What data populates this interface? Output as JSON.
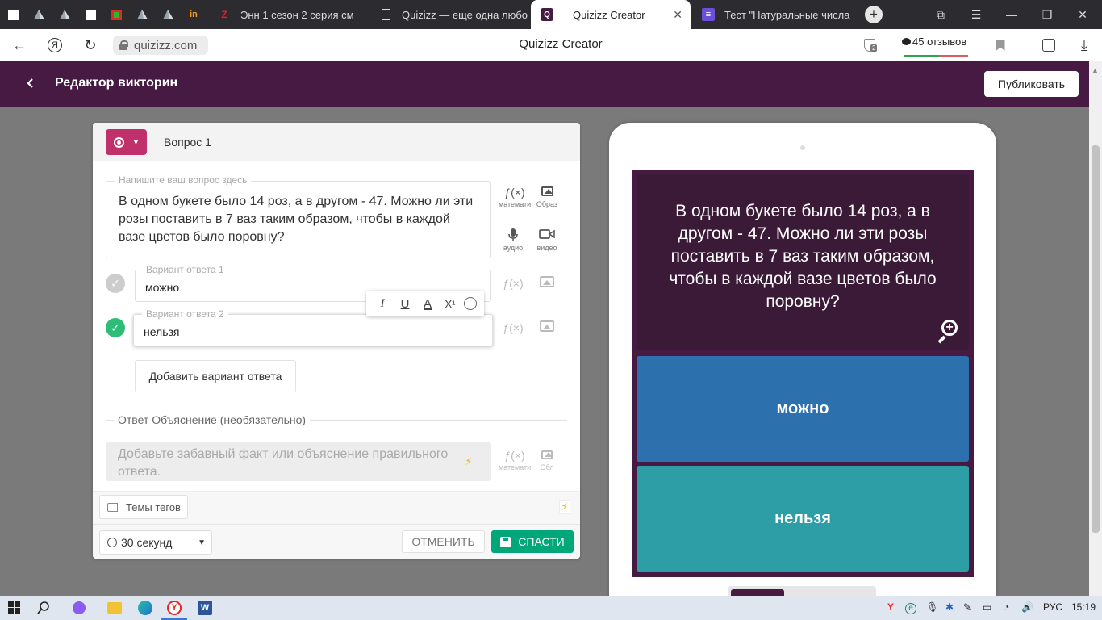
{
  "browser": {
    "mini_tabs": [
      {
        "icon": "white-square-icon"
      },
      {
        "icon": "pyramid-icon"
      },
      {
        "icon": "pyramid-icon"
      },
      {
        "icon": "white-square-icon"
      },
      {
        "icon": "green-red-square-icon"
      },
      {
        "icon": "pyramid-icon"
      },
      {
        "icon": "pyramid-icon"
      },
      {
        "icon": "in-logo-icon",
        "glyph": "in"
      }
    ],
    "tabs": [
      {
        "title": "Энн 1 сезон 2 серия см",
        "icon": "z-logo-icon",
        "fav": "Z"
      },
      {
        "title": "Quizizz — еще одна любо",
        "icon": "document-icon",
        "fav": ""
      },
      {
        "title": "Quizizz Creator",
        "icon": "quizizz-logo-icon",
        "fav": "Q",
        "active": true
      },
      {
        "title": "Тест \"Натуральные числа",
        "icon": "list-icon",
        "fav": "≡"
      }
    ],
    "url": "quizizz.com",
    "page_title": "Quizizz Creator",
    "shield_badge": "2",
    "reviews": "45 отзывов"
  },
  "header": {
    "title": "Редактор викторин",
    "publish_label": "Публиковать"
  },
  "editor": {
    "question_label": "Вопрос 1",
    "question_placeholder": "Напишите ваш вопрос здесь",
    "question_text": "В одном букете было 14 роз, а в другом - 47. Можно ли эти розы поставить в 7 ваз таким образом, чтобы в каждой вазе цветов было поровну?",
    "tools": {
      "math": "математика",
      "image": "Образ",
      "audio": "аудио",
      "video": "видео"
    },
    "answers": [
      {
        "label": "Вариант ответа 1",
        "text": "можно",
        "correct": false
      },
      {
        "label": "Вариант ответа 2",
        "text": "нельзя",
        "correct": true
      }
    ],
    "format_buttons": [
      "I",
      "U",
      "A",
      "X¹",
      "···"
    ],
    "add_answer_label": "Добавить вариант ответа",
    "explanation_label": "Ответ Объяснение (необязательно)",
    "explanation_placeholder": "Добавьте забавный факт или объяснение правильного ответа.",
    "explanation_tools": {
      "math": "математика",
      "image": "Обл"
    },
    "tags_label": "Темы тегов",
    "time_label": "30 секунд",
    "cancel_label": "ОТМЕНИТЬ",
    "save_label": "СПАСТИ"
  },
  "preview": {
    "question_text": "В одном букете было 14 роз, а в другом - 47. Можно ли эти розы поставить в 7 ваз таким образом, чтобы в каждой вазе цветов было поровну?",
    "options": [
      {
        "text": "можно",
        "color": "#2d70ae"
      },
      {
        "text": "нельзя",
        "color": "#2d9da6"
      }
    ]
  },
  "taskbar": {
    "language": "РУС",
    "time": "15:19"
  },
  "colors": {
    "brand": "#461a42",
    "qtype": "#c0306b",
    "save": "#00a779",
    "correct": "#2ebd76",
    "incorrect": "#cccccc"
  }
}
